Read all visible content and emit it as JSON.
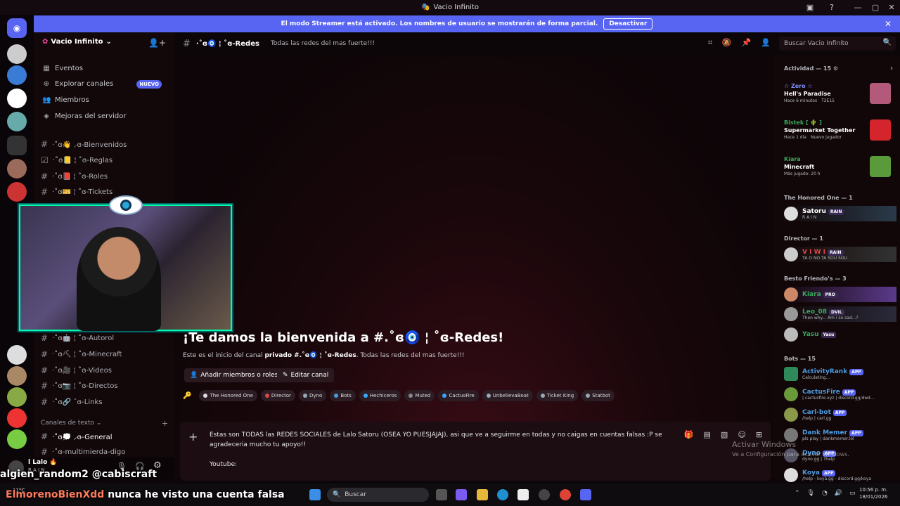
{
  "window": {
    "title": "Vacio Infinito"
  },
  "banner": {
    "text": "El modo Streamer está activado. Los nombres de usuario se mostrarán de forma parcial.",
    "button": "Desactivar"
  },
  "server": {
    "name": "Vacio Infinito"
  },
  "nav": [
    {
      "label": "Eventos",
      "icon": "calendar-icon"
    },
    {
      "label": "Explorar canales",
      "icon": "compass-icon",
      "badge": "NUEVO"
    },
    {
      "label": "Miembros",
      "icon": "people-icon"
    },
    {
      "label": "Mejoras del servidor",
      "icon": "boost-icon"
    }
  ],
  "channels_top": [
    {
      "label": "·˚ɞ👋 ⸝ɞ-Bienvenidos"
    },
    {
      "label": "·˚ɞ📒 ¦ ˚ɞ-Reglas"
    },
    {
      "label": "·˚ɞ📕 ¦ ˚ɞ-Roles"
    },
    {
      "label": "·˚ɞ🎫 ¦ ˚ɞ-Tickets"
    }
  ],
  "channels_mid": [
    {
      "label": "·˚ɞ🤖 ¦ ˚ɞ-Autorol"
    },
    {
      "label": "·˚ɞ⛏ ¦ ˚ɞ-Minecraft"
    },
    {
      "label": "·˚ɞ🎥 ¦ ˚ɞ-Videos"
    },
    {
      "label": "·˚ɞ📷 ¦ ˚ɞ-Directos"
    },
    {
      "label": "·˚ɞ🔗 ˘ɞ-Links"
    }
  ],
  "text_category": "Canales de texto",
  "channels_text": [
    {
      "label": "·˚ɞ💭 ⸝ɞ-General"
    },
    {
      "label": "·˚ɞ-multimierda-digo"
    }
  ],
  "user_panel": {
    "name": "l Lalo 🔥",
    "status": "R A I N"
  },
  "topbar": {
    "channel": "·˚ɞ🧿 ¦ ˚ɞ-Redes",
    "topic": "Todas las redes del mas fuerte!!!"
  },
  "search": {
    "placeholder": "Buscar Vacio Infinito"
  },
  "welcome": {
    "title": "¡Te damos la bienvenida a #.˚ɞ🧿 ¦ ˚ɞ-Redes!",
    "sub_prefix": "Este es el inicio del canal",
    "sub_bold": "privado #.˚ɞ🧿 ¦ ˚ɞ-Redes",
    "sub_suffix": ". Todas las redes del mas fuerte!!!",
    "btn_add": "Añadir miembros o roles",
    "btn_edit": "Editar canal"
  },
  "roles": [
    {
      "name": "The Honored One",
      "color": "#dddddd"
    },
    {
      "name": "Director",
      "color": "#e0464b"
    },
    {
      "name": "Dyno",
      "color": "#99aab5"
    },
    {
      "name": "Bots",
      "color": "#4b9be0"
    },
    {
      "name": "Hechiceros",
      "color": "#3ea6ff"
    },
    {
      "name": "Muted",
      "color": "#888888"
    },
    {
      "name": "CactusFire",
      "color": "#3ea6ff"
    },
    {
      "name": "UnbelievaBoat",
      "color": "#99aab5"
    },
    {
      "name": "Ticket King",
      "color": "#99aab5"
    },
    {
      "name": "Statbot",
      "color": "#99aab5"
    }
  ],
  "composer": {
    "text": "Estas son TODAS las REDES SOCIALES de Lalo Satoru (OSEA YO PUESJAJAJ), asi que ve a seguirme en todas y no caigas en cuentas falsas :P se agradeceria mucho tu apoyo!!",
    "line2": "Youtube:"
  },
  "watermark": {
    "title": "Activar Windows",
    "sub": "Ve a Configuración para activar Windows."
  },
  "activity": {
    "header": "Actividad — 15",
    "items": [
      {
        "user": "☆ Zero ☆",
        "color": "#7c8cff",
        "game": "Hell's Paradise",
        "meta1": "Hace 6 minutos",
        "meta2": "T2E15",
        "thumb": "#b35a7a"
      },
      {
        "user": "Bistek [ 🌵 ]",
        "color": "#3ba55d",
        "game": "Supermarket Together",
        "meta1": "Hace 1 día",
        "meta2": "Nuevo jugador",
        "thumb": "#d4242c"
      },
      {
        "user": "Kiara",
        "color": "#3ba55d",
        "game": "Minecraft",
        "meta1": "Más jugado: 20 h",
        "meta2": "",
        "thumb": "#5a9a3a"
      }
    ]
  },
  "groups": [
    {
      "header": "The Honored One — 1",
      "members": [
        {
          "name": "Satoru",
          "color": "#ffffff",
          "tag": "RAIN",
          "sub": "R A I N"
        }
      ]
    },
    {
      "header": "Director — 1",
      "members": [
        {
          "name": "V I W I",
          "color": "#e0464b",
          "tag": "RAIN",
          "sub": "TA O NO TA SOU SOU"
        }
      ]
    },
    {
      "header": "Besto Friendo's — 3",
      "members": [
        {
          "name": "Kiara",
          "color": "#3ba55d",
          "tag": "PRO",
          "sub": ""
        },
        {
          "name": "Leo_08",
          "color": "#3ba55d",
          "tag": "DVIL",
          "sub": "Then why... Am i so sad...?"
        },
        {
          "name": "Yasu",
          "color": "#3ba55d",
          "tag": "Yasu",
          "sub": ""
        }
      ]
    },
    {
      "header": "Bots — 15",
      "members": [
        {
          "name": "ActivityRank",
          "color": "#4b9be0",
          "tag": "APP",
          "sub": "Calculating..."
        },
        {
          "name": "CactusFire",
          "color": "#4b9be0",
          "tag": "APP",
          "sub": "| cactusfire.xyz | discord.gg/dw4..."
        },
        {
          "name": "Carl-bot",
          "color": "#4b9be0",
          "tag": "APP",
          "sub": "/help | carl.gg"
        },
        {
          "name": "Dank Memer",
          "color": "#4b9be0",
          "tag": "APP",
          "sub": "pls play | dankmemer.lol"
        },
        {
          "name": "Dyno",
          "color": "#4b9be0",
          "tag": "APP",
          "sub": "dyno.gg | ?help"
        },
        {
          "name": "Koya",
          "color": "#4b9be0",
          "tag": "APP",
          "sub": "/help - koya.gg - discord.gg/koya"
        }
      ]
    }
  ],
  "overlay": {
    "chat1": "algien_random2 @cabiscraft",
    "chat2_user": "ElmorenoBienXdd",
    "chat2_text": "nunca he visto una cuenta falsa"
  },
  "taskbar": {
    "search": "Buscar",
    "time": "10:56 p. m.",
    "date": "18/01/2026",
    "weather": "11°C"
  }
}
